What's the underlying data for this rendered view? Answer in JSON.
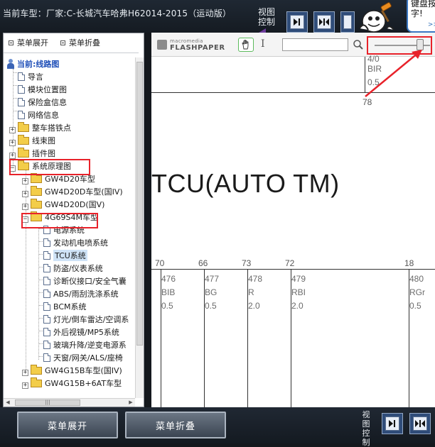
{
  "header": {
    "car_model": "当前车型：厂家:C-长城汽车哈弗H62014-2015（运动版）",
    "view_control": "视图控制",
    "tip_text": "键盘按字!",
    "tip_more": ">>"
  },
  "tree_toolbar": {
    "expand_label": "菜单展开",
    "collapse_label": "菜单折叠"
  },
  "tree": {
    "root": "当前:线路图",
    "items": [
      {
        "label": "导言"
      },
      {
        "label": "模块位置图"
      },
      {
        "label": "保险盒信息"
      },
      {
        "label": "网络信息"
      },
      {
        "label": "整车搭铁点"
      },
      {
        "label": "线束图"
      },
      {
        "label": "插件图"
      },
      {
        "label": "系统原理图"
      },
      {
        "label": "GW4D20车型"
      },
      {
        "label": "GW4D20D车型(国IV)"
      },
      {
        "label": "GW4D20D(国V)"
      },
      {
        "label": "4G69S4M车型"
      },
      {
        "label": "电源系统"
      },
      {
        "label": "发动机电喷系统"
      },
      {
        "label": "TCU系统"
      },
      {
        "label": "防盗/仪表系统"
      },
      {
        "label": "诊断仪接口/安全气囊"
      },
      {
        "label": "ABS/雨刮洗涤系统"
      },
      {
        "label": "BCM系统"
      },
      {
        "label": "灯光/倒车雷达/空调系"
      },
      {
        "label": "外后视镜/MP5系统"
      },
      {
        "label": "玻璃升降/逆变电源系"
      },
      {
        "label": "天窗/网关/ALS/座椅"
      },
      {
        "label": "GW4G15B车型(国IV)"
      },
      {
        "label": "GW4G15B+6AT车型"
      }
    ]
  },
  "viewer": {
    "logo_small": "macromedia",
    "logo_big": "FLASHPAPER",
    "text_tool": "I",
    "search_value": "",
    "zoom_level": 0.82
  },
  "document": {
    "title": "TCU(AUTO TM)",
    "top_pin": {
      "wire": "BIR",
      "size": "0.5",
      "pin": "78",
      "partial_top": "4/0"
    },
    "wires": [
      {
        "pin": "70",
        "wire": "476",
        "color": "BIB",
        "size": "0.5"
      },
      {
        "pin": "66",
        "wire": "477",
        "color": "BG",
        "size": "0.5"
      },
      {
        "pin": "73",
        "wire": "478",
        "color": "R",
        "size": "2.0"
      },
      {
        "pin": "72",
        "wire": "479",
        "color": "RBI",
        "size": "2.0"
      },
      {
        "pin": "18",
        "wire": "480",
        "color": "RGr",
        "size": "0.5"
      }
    ]
  },
  "footer": {
    "expand_button": "菜单展开",
    "collapse_button": "菜单折叠",
    "view_control": "视图控制"
  },
  "colors": {
    "highlight_red": "#e8222a",
    "header_bg": "#1a222b",
    "folder_yellow": "#f3cd49"
  }
}
